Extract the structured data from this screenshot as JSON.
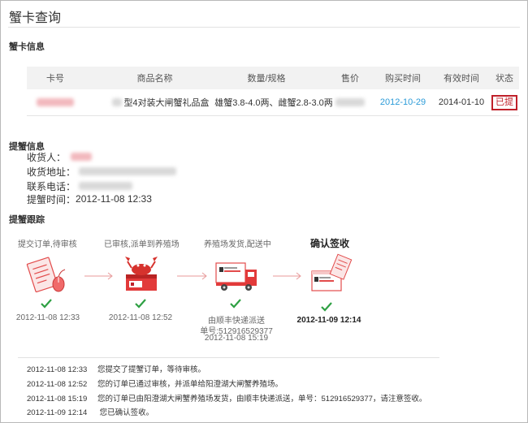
{
  "page": {
    "title": "蟹卡查询"
  },
  "card_info": {
    "section_label": "蟹卡信息",
    "headers": {
      "card_no": "卡号",
      "product": "商品名称",
      "spec": "数量/规格",
      "price": "售价",
      "purchase_time": "购买时间",
      "valid_time": "有效时间",
      "status": "状态"
    },
    "row": {
      "product": "型4对装大闸蟹礼品盒",
      "spec": "雄蟹3.8-4.0两、雌蟹2.8-3.0两",
      "purchase_time": "2012-10-29",
      "valid_time": "2014-01-10",
      "status": "已提"
    }
  },
  "pickup_info": {
    "section_label": "提蟹信息",
    "receiver_label": "收货人：",
    "address_label": "收货地址：",
    "phone_label": "联系电话：",
    "time_label": "提蟹时间：",
    "time_value": "2012-11-08 12:33"
  },
  "tracking": {
    "section_label": "提蟹跟踪",
    "steps": [
      {
        "caption": "提交订单,待审核",
        "time": "2012-11-08 12:33",
        "icon": "document-order-icon"
      },
      {
        "caption": "已审核,派单到养殖场",
        "time": "2012-11-08 12:52",
        "icon": "crab-box-icon"
      },
      {
        "caption": "养殖场发货,配送中",
        "time": "2012-11-08 15:19",
        "icon": "delivery-truck-icon",
        "courier": "由顺丰快递派送",
        "waybill": "单号:512916529377"
      },
      {
        "caption": "确认签收",
        "time": "2012-11-09 12:14",
        "icon": "signed-box-icon"
      }
    ],
    "logs": [
      {
        "time": "2012-11-08 12:33",
        "text": "您提交了提蟹订单，等待审核。"
      },
      {
        "time": "2012-11-08 12:52",
        "text": "您的订单已通过审核，并派单给阳澄湖大闸蟹养殖场。"
      },
      {
        "time": "2012-11-08 15:19",
        "text": "您的订单已由阳澄湖大闸蟹养殖场发货，由顺丰快递派送，单号：512916529377，请注意签收。"
      },
      {
        "time": "2012-11-09 12:14",
        "text": " 您已确认签收。"
      }
    ]
  },
  "colors": {
    "accent_red": "#c0202a",
    "link_blue": "#2b9bd8",
    "check_green": "#2ea043"
  }
}
